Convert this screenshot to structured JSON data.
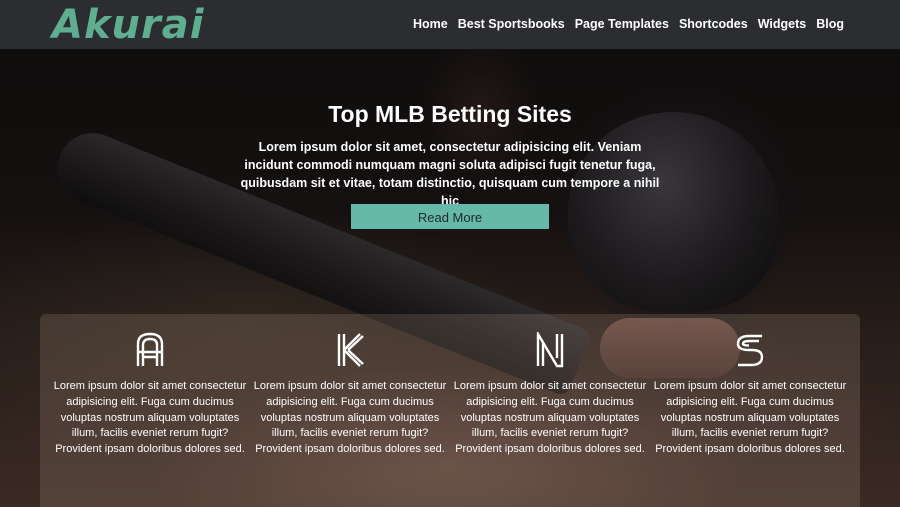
{
  "header": {
    "logo_text": "Akurai",
    "nav": [
      {
        "label": "Home"
      },
      {
        "label": "Best Sportsbooks"
      },
      {
        "label": "Page Templates"
      },
      {
        "label": "Shortcodes"
      },
      {
        "label": "Widgets"
      },
      {
        "label": "Blog"
      }
    ]
  },
  "hero": {
    "title": "Top MLB Betting Sites",
    "text": "Lorem ipsum dolor sit amet, consectetur adipisicing elit. Veniam incidunt commodi numquam magni soluta adipisci fugit tenetur fuga, quibusdam sit et vitae, totam distinctio, quisquam cum tempore a nihil hic",
    "button_label": "Read More"
  },
  "features": [
    {
      "icon": "letter-a-icon",
      "text": "Lorem ipsum dolor sit amet consectetur adipisicing elit. Fuga cum ducimus voluptas nostrum aliquam voluptates illum, facilis eveniet rerum fugit? Provident ipsam doloribus dolores sed."
    },
    {
      "icon": "letter-k-icon",
      "text": "Lorem ipsum dolor sit amet consectetur adipisicing elit. Fuga cum ducimus voluptas nostrum aliquam voluptates illum, facilis eveniet rerum fugit? Provident ipsam doloribus dolores sed."
    },
    {
      "icon": "letter-n-icon",
      "text": "Lorem ipsum dolor sit amet consectetur adipisicing elit. Fuga cum ducimus voluptas nostrum aliquam voluptates illum, facilis eveniet rerum fugit? Provident ipsam doloribus dolores sed."
    },
    {
      "icon": "letter-s-icon",
      "text": "Lorem ipsum dolor sit amet consectetur adipisicing elit. Fuga cum ducimus voluptas nostrum aliquam voluptates illum, facilis eveniet rerum fugit? Provident ipsam doloribus dolores sed."
    }
  ],
  "colors": {
    "header_bg": "#2b2d31",
    "logo": "#5fae92",
    "button_bg": "#66b8a8"
  }
}
